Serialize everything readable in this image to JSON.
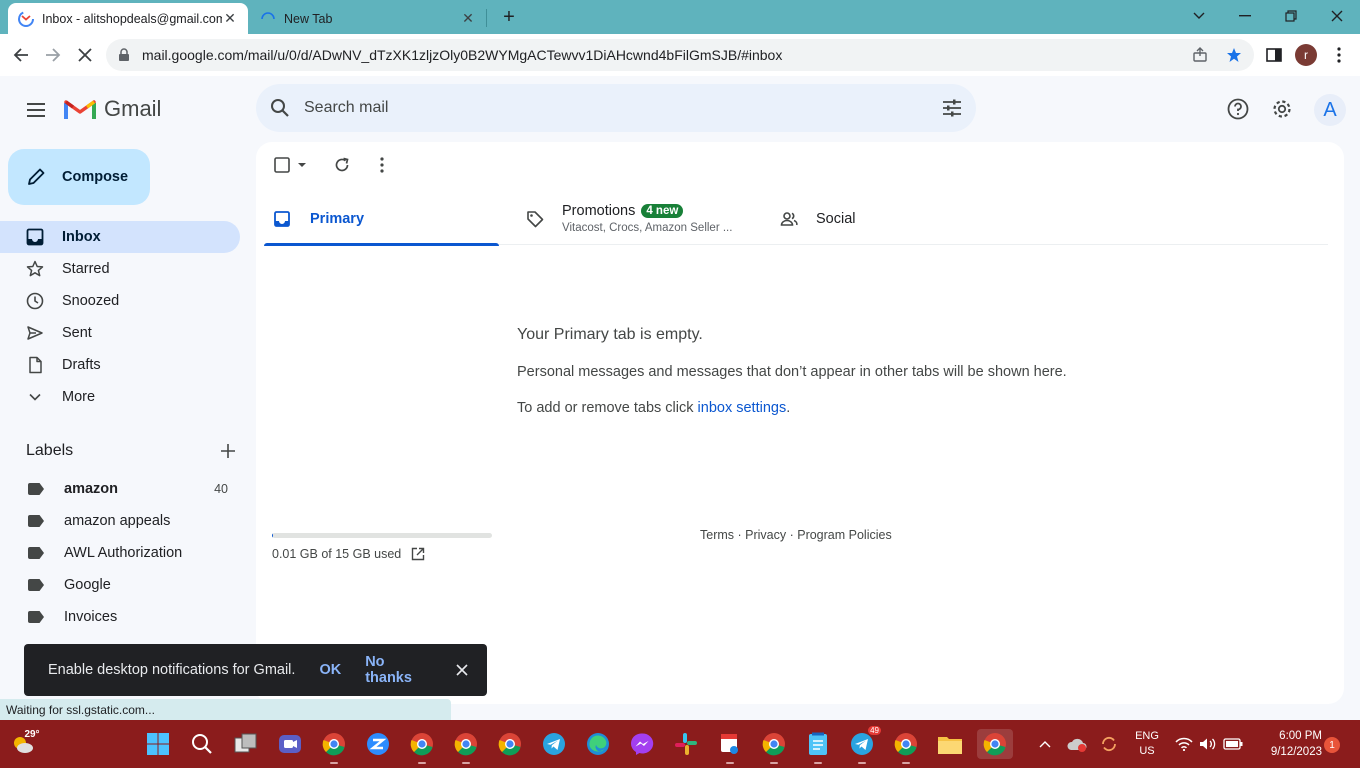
{
  "browser": {
    "active_tab_title": "Inbox - alitshopdeals@gmail.com",
    "inactive_tab_title": "New Tab",
    "url": "mail.google.com/mail/u/0/d/ADwNV_dTzXK1zljzOly0B2WYMgACTewvv1DiAHcwnd4bFilGmSJB/#inbox",
    "profile_initial": "r",
    "status_text": "Waiting for ssl.gstatic.com..."
  },
  "header": {
    "app_name": "Gmail",
    "search_placeholder": "Search mail",
    "account_initial": "A"
  },
  "sidebar": {
    "compose_label": "Compose",
    "items": [
      {
        "label": "Inbox",
        "icon": "inbox-icon"
      },
      {
        "label": "Starred",
        "icon": "star-icon"
      },
      {
        "label": "Snoozed",
        "icon": "clock-icon"
      },
      {
        "label": "Sent",
        "icon": "send-icon"
      },
      {
        "label": "Drafts",
        "icon": "draft-icon"
      },
      {
        "label": "More",
        "icon": "chevron-down-icon"
      }
    ],
    "labels_heading": "Labels",
    "labels": [
      {
        "name": "amazon",
        "count": "40"
      },
      {
        "name": "amazon appeals"
      },
      {
        "name": "AWL Authorization"
      },
      {
        "name": "Google"
      },
      {
        "name": "Invoices"
      }
    ]
  },
  "main": {
    "tabs": {
      "primary": "Primary",
      "promotions": "Promotions",
      "promotions_badge": "4 new",
      "promotions_snippet": "Vitacost, Crocs, Amazon Seller ...",
      "social": "Social"
    },
    "empty_title": "Your Primary tab is empty.",
    "empty_line1": "Personal messages and messages that don’t appear in other tabs will be shown here.",
    "empty_line2_prefix": "To add or remove tabs click ",
    "empty_line2_link": "inbox settings",
    "empty_line2_suffix": ".",
    "storage_text": "0.01 GB of 15 GB used",
    "storage_fraction": 0.0007,
    "footer": {
      "terms": "Terms",
      "sep": " · ",
      "privacy": "Privacy",
      "policies": "Program Policies"
    }
  },
  "snackbar": {
    "message": "Enable desktop notifications for Gmail.",
    "ok": "OK",
    "no_thanks": "No thanks"
  },
  "taskbar": {
    "weather": "29°",
    "lang_1": "ENG",
    "lang_2": "US",
    "time": "6:00 PM",
    "date": "9/12/2023",
    "notification_count": "1",
    "telegram_badge": "49"
  }
}
